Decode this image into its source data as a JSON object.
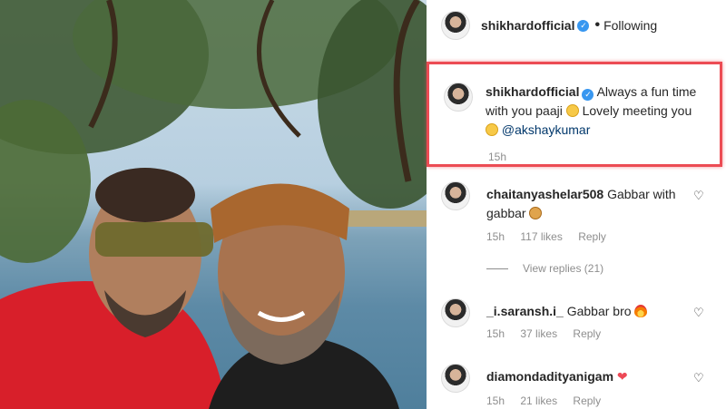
{
  "post": {
    "author": "shikhardofficial",
    "follow_status": "Following",
    "caption_text_1": "Always a fun time with you paaji",
    "caption_text_2": "Lovely meeting you",
    "caption_mention": "@akshaykumar",
    "caption_time": "15h"
  },
  "comments": [
    {
      "user": "chaitanyashelar508",
      "text": "Gabbar with gabbar",
      "time": "15h",
      "likes": "117 likes",
      "reply": "Reply"
    },
    {
      "user": "_i.saransh.i_",
      "text": "Gabbar bro",
      "time": "15h",
      "likes": "37 likes",
      "reply": "Reply"
    },
    {
      "user": "diamondadityanigam",
      "text": "",
      "time": "15h",
      "likes": "21 likes",
      "reply": "Reply"
    }
  ],
  "view_replies": "View replies (21)",
  "colors": {
    "highlight": "#ec4c54",
    "verified": "#3897f0",
    "mention": "#00376b",
    "meta": "#8e8e8e"
  },
  "icons": {
    "verified": "verified-badge-icon",
    "like": "heart-outline-icon"
  }
}
